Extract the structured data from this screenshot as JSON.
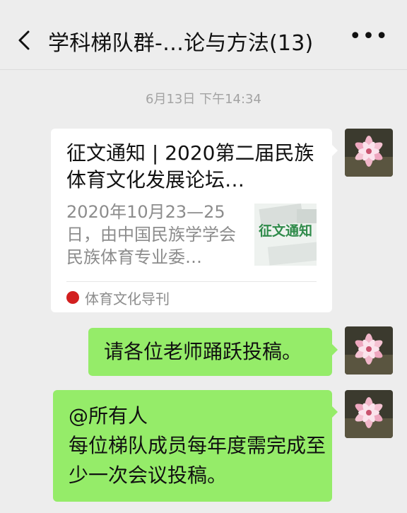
{
  "header": {
    "title": "学科梯队群-…论与方法(13)",
    "more_label": "•••"
  },
  "timestamp": "6月13日 下午14:34",
  "messages": {
    "card": {
      "title": "征文通知 | 2020第二届民族体育文化发展论坛…",
      "description": "2020年10月23—25日，由中国民族学学会民族体育专业委…",
      "thumb_text": "征文通知",
      "source": "体育文化导刊"
    },
    "msg1": "请各位老师踊跃投稿。",
    "msg2_line1": "@所有人",
    "msg2_line2": "每位梯队成员每年度需完成至少一次会议投稿。"
  },
  "colors": {
    "background": "#ededed",
    "bubble_green": "#95ec69",
    "card_white": "#ffffff",
    "source_logo_red": "#d21f1f"
  },
  "icons": [
    "back-chevron-icon",
    "more-icon",
    "avatar-lily-image",
    "source-logo-icon"
  ]
}
